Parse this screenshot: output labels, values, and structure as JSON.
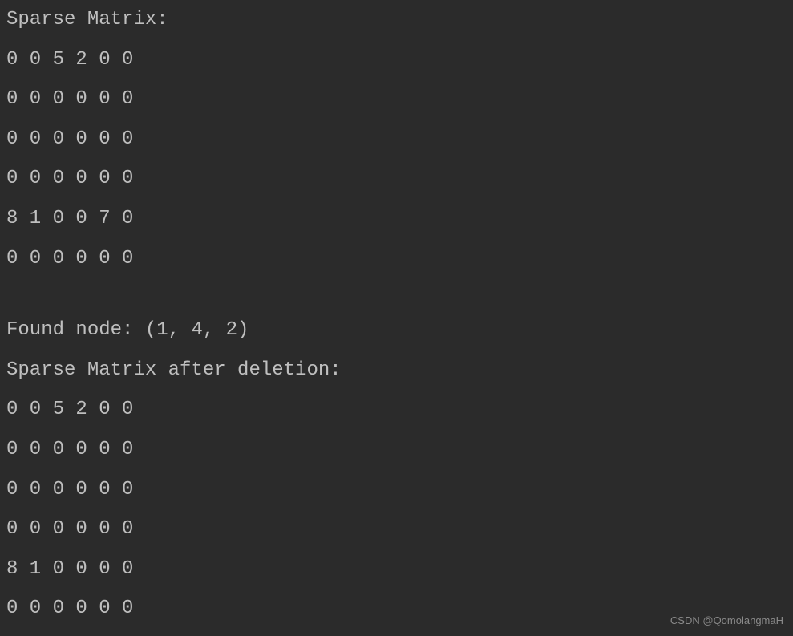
{
  "terminal": {
    "header1": "Sparse Matrix:",
    "matrix1": [
      "0 0 5 2 0 0",
      "0 0 0 0 0 0",
      "0 0 0 0 0 0",
      "0 0 0 0 0 0",
      "8 1 0 0 7 0",
      "0 0 0 0 0 0"
    ],
    "found_node": "Found node: (1, 4, 2)",
    "header2": "Sparse Matrix after deletion:",
    "matrix2": [
      "0 0 5 2 0 0",
      "0 0 0 0 0 0",
      "0 0 0 0 0 0",
      "0 0 0 0 0 0",
      "8 1 0 0 0 0",
      "0 0 0 0 0 0"
    ]
  },
  "watermark": "CSDN @QomolangmaH"
}
